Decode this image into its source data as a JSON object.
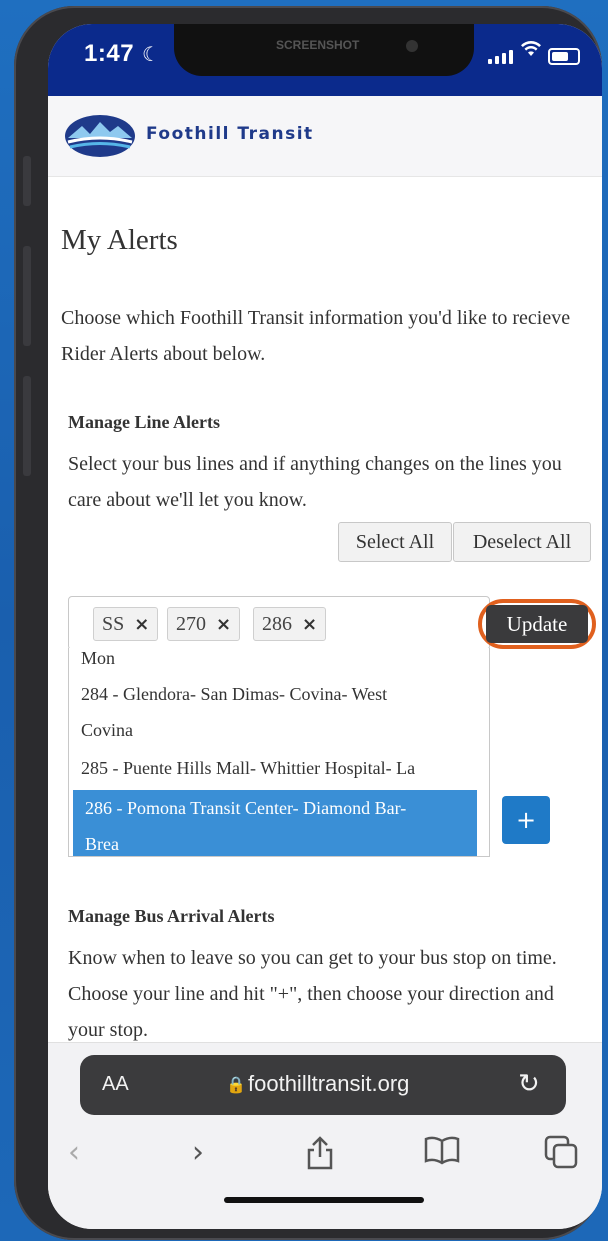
{
  "status": {
    "time": "1:47",
    "notch_label": "SCREENSHOT"
  },
  "brand": {
    "name": "Foothill Transit"
  },
  "page": {
    "title": "My Alerts",
    "intro": "Choose which Foothill Transit information you'd like to recieve Rider Alerts about below."
  },
  "line_alerts": {
    "title": "Manage Line Alerts",
    "description": "Select your bus lines and if anything changes on the lines you care about we'll let you know.",
    "select_all": "Select All",
    "deselect_all": "Deselect All",
    "tags": [
      {
        "label": "SS",
        "remove": "×"
      },
      {
        "label": "270",
        "remove": "×"
      },
      {
        "label": "286",
        "remove": "×"
      }
    ],
    "update_label": "Update",
    "options": [
      "Mon",
      "284 - Glendora- San Dimas- Covina- West",
      "Covina",
      "285 - Puente Hills Mall- Whittier Hospital- La",
      "286 - Pomona Transit Center- Diamond Bar-",
      "Brea"
    ],
    "selected_option": "286 - Pomona Transit Center- Diamond Bar-Brea"
  },
  "arrival_alerts": {
    "title": "Manage Bus Arrival Alerts",
    "description": "Know when to leave so you can get to your bus stop on time. Choose your line and hit \"+\", then choose your direction and your stop.",
    "add_label": "+"
  },
  "browser": {
    "text_size_label": "AA",
    "url": "foothilltransit.org",
    "icons": [
      "back-icon",
      "forward-icon",
      "share-icon",
      "bookmarks-icon",
      "tabs-icon",
      "reload-icon",
      "lock-icon"
    ]
  },
  "colors": {
    "brand_navy": "#0b2a8c",
    "selected_blue": "#3a8fd6",
    "add_blue": "#1f7ac7",
    "highlight_ring": "#e0601e"
  }
}
